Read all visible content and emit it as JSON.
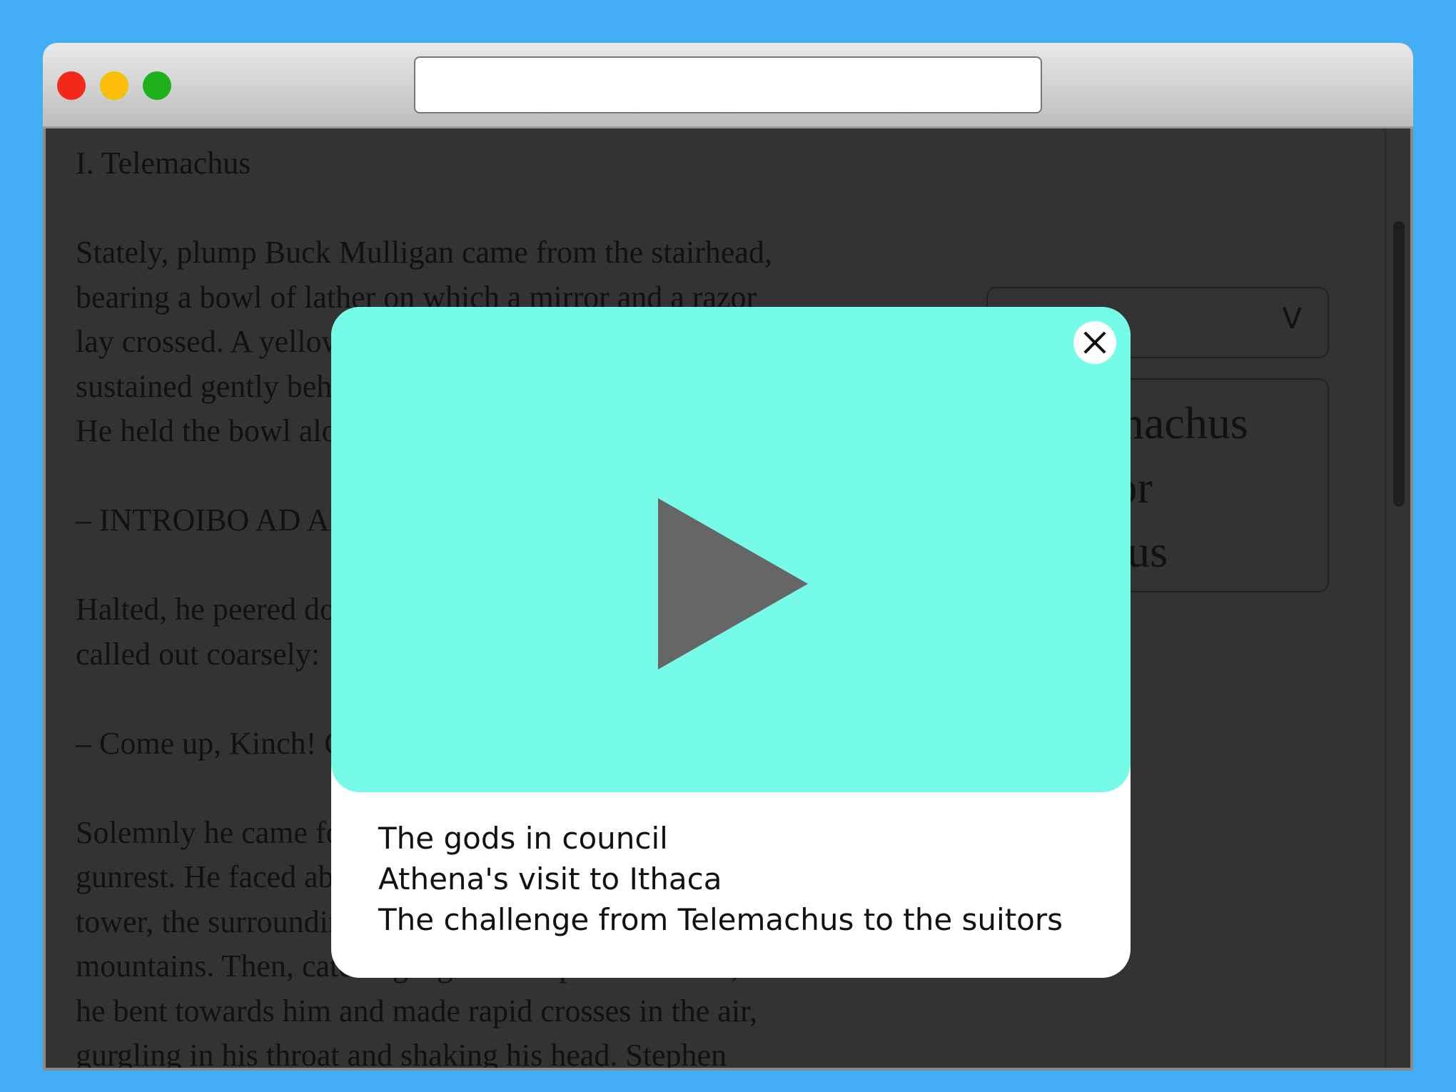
{
  "browser": {
    "url": ""
  },
  "article": {
    "heading": "I. Telemachus",
    "paragraphs": [
      "Stately, plump Buck Mulligan came from the stairhead,\nbearing a bowl of lather on which a mirror and a razor\nlay crossed. A yellow dressinggown, ungirdled, was\nsustained gently behind him on the mild morning air.\nHe held the bowl aloft and intoned:",
      "– INTROIBO AD ALTARE DEI.",
      "Halted, he peered down the dark winding stairs and\ncalled out coarsely:",
      "– Come up, Kinch! Come up, you fearful jesuit!",
      "Solemnly he came forward and mounted the round\ngunrest. He faced about and blessed gravely thrice the\ntower, the surrounding land and the awaking\nmountains. Then, catching sight of Stephen Dedalus,\nhe bent towards him and made rapid crosses in the air,\ngurgling in his throat and shaking his head. Stephen"
    ]
  },
  "chapter_select": {
    "selected": "T",
    "chevron": "V",
    "options": [
      "Telemachus",
      "Nestor",
      "Proteus"
    ]
  },
  "modal": {
    "captions": [
      "The gods in council",
      "Athena's visit to Ithaca",
      "The challenge from Telemachus to the suitors"
    ],
    "video_color": "#76FBE8",
    "play_color": "#666666"
  }
}
